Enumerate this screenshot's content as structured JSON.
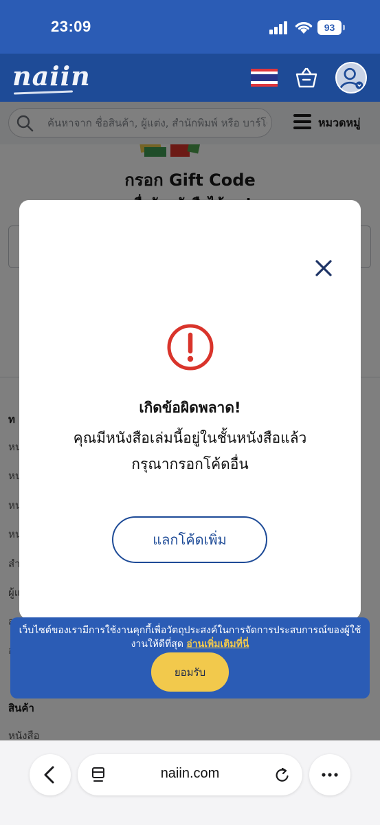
{
  "status_bar": {
    "time": "23:09",
    "battery": "93"
  },
  "header": {
    "logo": "naiin"
  },
  "search": {
    "placeholder": "ค้นหาจาก ชื่อสินค้า, ผู้แต่ง, สำนักพิมพ์ หรือ บาร์โค้ด",
    "category_label": "หมวดหมู่"
  },
  "background_page": {
    "title": "กรอก Gift Code",
    "subtitle": "เพื่อรับหนังสือได้เลย!",
    "footer_heading": "ท",
    "footer_links": [
      "หน",
      "หน",
      "หน",
      "หน",
      "สำ",
      "ผู้แ",
      "ส",
      "อ"
    ],
    "products_heading": "สินค้า",
    "products_link": "หนังสือ"
  },
  "modal": {
    "title": "เกิดข้อผิดพลาด!",
    "message_line1": "คุณมีหนังสือเล่มนี้อยู่ในชั้นหนังสือแล้ว",
    "message_line2": "กรุณากรอกโค้ดอื่น",
    "button_label": "แลกโค้ดเพิ่ม",
    "error_color": "#d9342b",
    "accent_color": "#1e4b97"
  },
  "cookie_banner": {
    "text": "เว็บไซต์ของเรามีการใช้งานคุกกี้เพื่อวัตถุประสงค์ในการจัดการประสบการณ์ของผู้ใช้งานให้ดีที่สุด",
    "link_text": "อ่านเพิ่มเติมที่นี่",
    "accept_label": "ยอมรับ"
  },
  "browser": {
    "url": "naiin.com"
  },
  "icons": {
    "signal": "signal-icon",
    "wifi": "wifi-icon",
    "battery": "battery-icon",
    "flag": "thai-flag-icon",
    "basket": "basket-icon",
    "avatar": "user-avatar-icon",
    "search": "search-icon",
    "menu": "hamburger-menu-icon",
    "close": "close-icon",
    "error": "exclamation-circle-icon",
    "back": "chevron-left-icon",
    "tabs": "tab-icon",
    "reload": "reload-icon",
    "more": "more-dots-icon"
  }
}
